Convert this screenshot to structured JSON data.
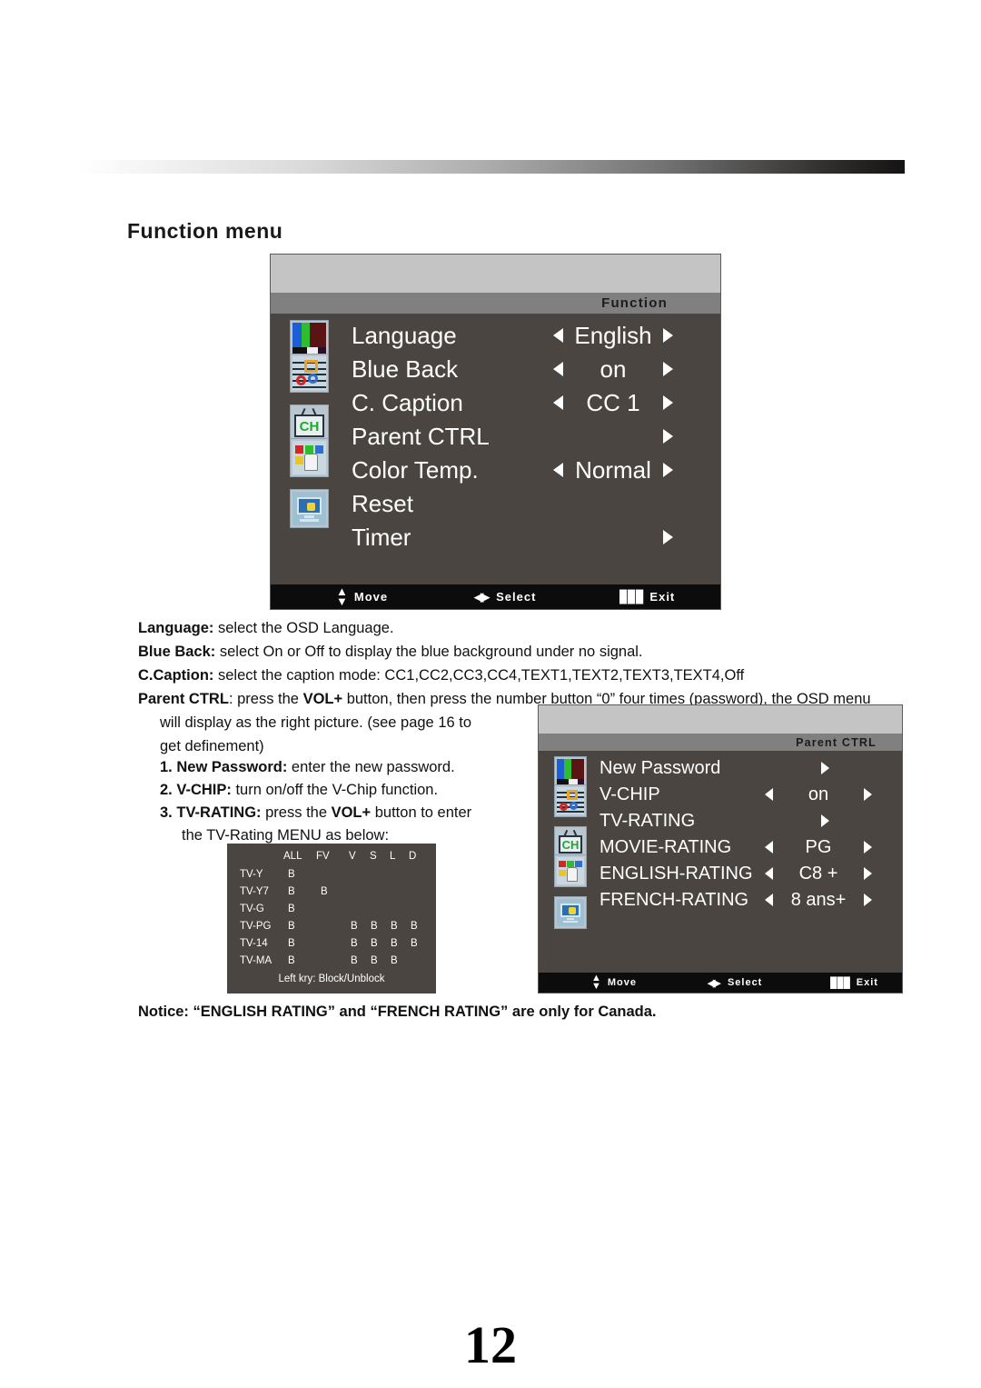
{
  "page": {
    "heading": "Function  menu",
    "number": "12"
  },
  "function_menu": {
    "title": "Function",
    "items": [
      {
        "icon": "colorbars-icon",
        "label": "Language",
        "value": "English",
        "left_arrow": true,
        "right_arrow": true
      },
      {
        "icon": "caption-icon",
        "label": "Blue  Back",
        "value": "on",
        "left_arrow": true,
        "right_arrow": true
      },
      {
        "icon": "caption-icon",
        "label": "C. Caption",
        "value": "CC 1",
        "left_arrow": true,
        "right_arrow": true
      },
      {
        "icon": "channel-icon",
        "label": "Parent  CTRL",
        "value": "",
        "left_arrow": false,
        "right_arrow": true
      },
      {
        "icon": "hand-icon",
        "label": "Color  Temp.",
        "value": "Normal",
        "left_arrow": true,
        "right_arrow": true
      },
      {
        "icon": "hand-icon",
        "label": "Reset",
        "value": "",
        "left_arrow": false,
        "right_arrow": false
      },
      {
        "icon": "monitor-icon",
        "label": "Timer",
        "value": "",
        "left_arrow": false,
        "right_arrow": true
      }
    ],
    "footer": {
      "move": "Move",
      "select": "Select",
      "exit": "Exit"
    }
  },
  "parent_ctrl_menu": {
    "title": "Parent CTRL",
    "items": [
      {
        "icon": "colorbars-icon",
        "label": "NEW PASSWORD",
        "display_label": "New Password",
        "value": "",
        "left_arrow": false,
        "right_arrow": true
      },
      {
        "icon": "caption-icon",
        "label": "V-CHIP",
        "display_label": "V-CHIP",
        "value": "on",
        "left_arrow": true,
        "right_arrow": true
      },
      {
        "icon": "caption-icon",
        "label": "TV-RATING",
        "display_label": "TV-RATING",
        "value": "",
        "left_arrow": false,
        "right_arrow": true
      },
      {
        "icon": "channel-icon",
        "label": "MOVIE-RATING",
        "display_label": "MOVIE-RATING",
        "value": "PG",
        "left_arrow": true,
        "right_arrow": true
      },
      {
        "icon": "hand-icon",
        "label": "ENGLISH-RATING",
        "display_label": "ENGLISH-RATING",
        "value": "C8 +",
        "left_arrow": true,
        "right_arrow": true
      },
      {
        "icon": "hand-icon",
        "label": "FRENCH-RATING",
        "display_label": "FRENCH-RATING",
        "value": "8 ans+",
        "left_arrow": true,
        "right_arrow": true
      },
      {
        "icon": "monitor-icon",
        "label": "",
        "display_label": "",
        "value": "",
        "left_arrow": false,
        "right_arrow": false
      }
    ],
    "footer": {
      "move": "Move",
      "select": "Select",
      "exit": "Exit"
    }
  },
  "rating_table": {
    "columns": [
      "ALL",
      "FV",
      "V",
      "S",
      "L",
      "D"
    ],
    "rows": [
      {
        "name": "TV-Y",
        "cells": [
          "B",
          "",
          "",
          "",
          "",
          ""
        ]
      },
      {
        "name": "TV-Y7",
        "cells": [
          "B",
          "B",
          "",
          "",
          "",
          ""
        ]
      },
      {
        "name": "TV-G",
        "cells": [
          "B",
          "",
          "",
          "",
          "",
          ""
        ]
      },
      {
        "name": "TV-PG",
        "cells": [
          "B",
          "",
          "B",
          "B",
          "B",
          "B"
        ]
      },
      {
        "name": "TV-14",
        "cells": [
          "B",
          "",
          "B",
          "B",
          "B",
          "B"
        ]
      },
      {
        "name": "TV-MA",
        "cells": [
          "B",
          "",
          "B",
          "B",
          "B",
          ""
        ]
      }
    ],
    "footnote": "Left kry: Block/Unblock"
  },
  "descriptions": {
    "language_term": "Language:",
    "language_text": " select the OSD Language.",
    "blueback_term": "Blue Back:",
    "blueback_text": " select On or Off to display the blue background under no signal.",
    "ccaption_term": "C.Caption:",
    "ccaption_text": " select the caption mode: CC1,CC2,CC3,CC4,TEXT1,TEXT2,TEXT3,TEXT4,Off",
    "parentctrl_term": "Parent CTRL",
    "parentctrl_text_1": ": press the ",
    "parentctrl_bold_vol": "VOL+",
    "parentctrl_text_2": " button, then press the number button “0” four times (password), the OSD menu",
    "parentctrl_cont_1": "will display as the right picture. (see page 16 to",
    "parentctrl_cont_2": "get definement)",
    "item1_num": "1. ",
    "item1_term": "New Password:",
    "item1_text": " enter the new password.",
    "item2_num": "2. ",
    "item2_term": "V-CHIP:",
    "item2_text": " turn on/off the V-Chip function.",
    "item3_num": "3. ",
    "item3_term": "TV-RATING:",
    "item3_text_1": " press the ",
    "item3_bold_vol": "VOL+",
    "item3_text_2": " button to enter",
    "item3_cont": "the TV-Rating MENU as below:"
  },
  "notice": {
    "text": "Notice: “ENGLISH RATING” and “FRENCH RATING” are only for Canada."
  },
  "colors": {
    "osd_body": "#4a4540",
    "osd_title_band": "#808080",
    "osd_top_band": "#c4c4c4",
    "osd_footer": "#0d0c0c",
    "text_white": "#ffffff",
    "page_text": "#111111"
  }
}
